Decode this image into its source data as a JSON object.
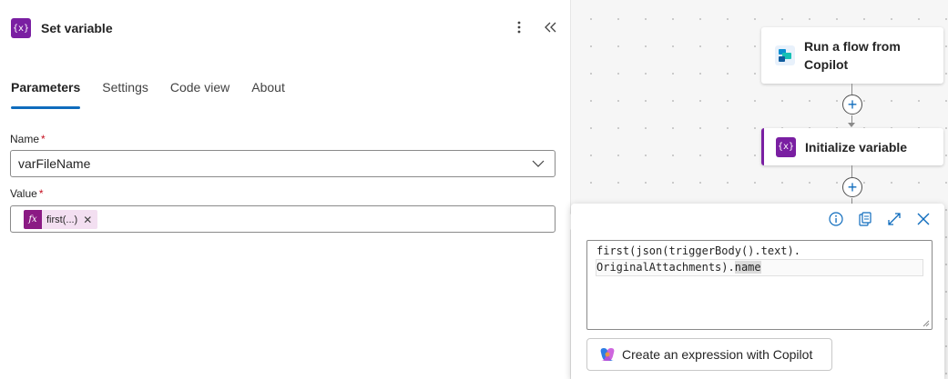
{
  "panel": {
    "title": "Set variable",
    "more_icon": "more-vertical-icon",
    "collapse_icon": "double-chevron-left-icon",
    "tabs": [
      {
        "label": "Parameters",
        "active": true
      },
      {
        "label": "Settings",
        "active": false
      },
      {
        "label": "Code view",
        "active": false
      },
      {
        "label": "About",
        "active": false
      }
    ],
    "name_field": {
      "label": "Name",
      "required_mark": "*",
      "value": "varFileName"
    },
    "value_field": {
      "label": "Value",
      "required_mark": "*",
      "token_label": "first(...)",
      "token_icon": "fx"
    }
  },
  "canvas": {
    "nodes": [
      {
        "label": "Run a flow from Copilot",
        "icon": "copilot-studio-icon"
      },
      {
        "label": "Initialize variable",
        "icon": "variable-icon"
      }
    ]
  },
  "popup": {
    "tools": [
      "info-icon",
      "copy-icon",
      "expand-icon",
      "close-icon"
    ],
    "code_line_1": "first(json(triggerBody().text).",
    "code_line_2_prefix": "OriginalAttachments).",
    "code_line_2_highlight": "name",
    "copilot_button": "Create an expression with Copilot"
  },
  "colors": {
    "accent": "#0f6cbd",
    "variable_purple": "#7a1fa2",
    "token_magenta": "#8b1a84"
  }
}
